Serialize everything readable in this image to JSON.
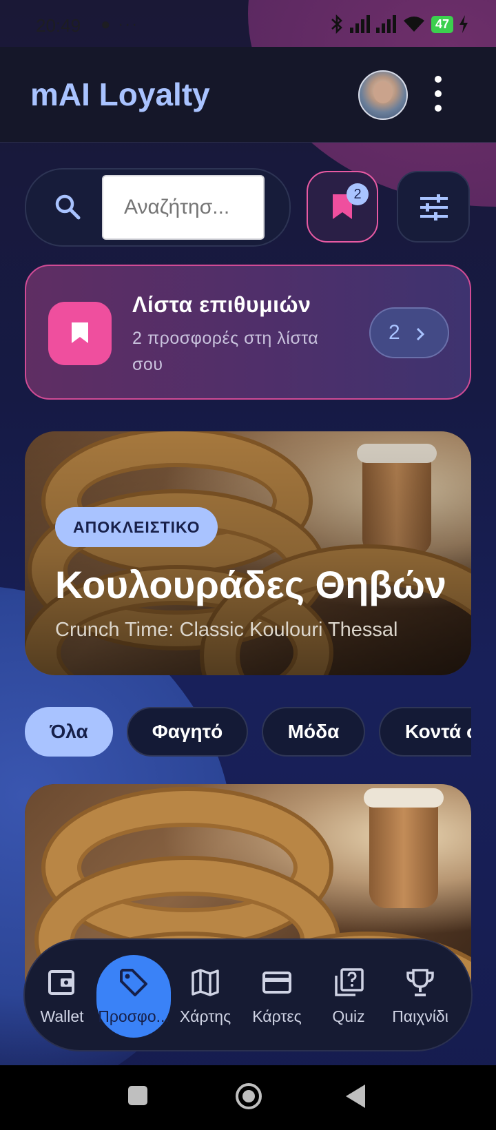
{
  "status_bar": {
    "time": "20:49",
    "notification_icons": "● ···",
    "battery_level": "47"
  },
  "app_bar": {
    "title": "mAI Loyalty",
    "avatar_icon": "user-avatar",
    "menu_icon": "more-vert-icon"
  },
  "search": {
    "placeholder": "Αναζήτησ...",
    "value": "",
    "icon": "search-icon"
  },
  "bookmarks_button": {
    "icon": "bookmark-icon",
    "badge": "2"
  },
  "filter_button": {
    "icon": "tune-icon"
  },
  "wishlist_card": {
    "title": "Λίστα επιθυμιών",
    "subtitle": "2 προσφορές στη λίστα σου",
    "count": "2",
    "icon": "bookmark-icon",
    "colors": {
      "accent": "#ef4f9e",
      "border": "#d14b95"
    }
  },
  "featured_offer": {
    "badge": "ΑΠΟΚΛΕΙΣΤΙΚΟ",
    "title": "Κουλουράδες Θηβών",
    "subtitle": "Crunch Time: Classic Koulouri Thessal"
  },
  "categories": [
    {
      "label": "Όλα",
      "active": true
    },
    {
      "label": "Φαγητό",
      "active": false
    },
    {
      "label": "Μόδα",
      "active": false
    },
    {
      "label": "Κοντά σ",
      "active": false
    }
  ],
  "bottom_nav": {
    "active_index": 1,
    "items": [
      {
        "label": "Wallet",
        "icon": "wallet-icon"
      },
      {
        "label": "Προσφο...",
        "icon": "tag-icon"
      },
      {
        "label": "Χάρτης",
        "icon": "map-icon"
      },
      {
        "label": "Κάρτες",
        "icon": "credit-card-icon"
      },
      {
        "label": "Quiz",
        "icon": "quiz-icon"
      },
      {
        "label": "Παιχνίδι",
        "icon": "trophy-icon"
      }
    ]
  },
  "theme": {
    "primary": "#a9c3ff",
    "active_nav": "#3a82f7",
    "background": "#161a44"
  }
}
